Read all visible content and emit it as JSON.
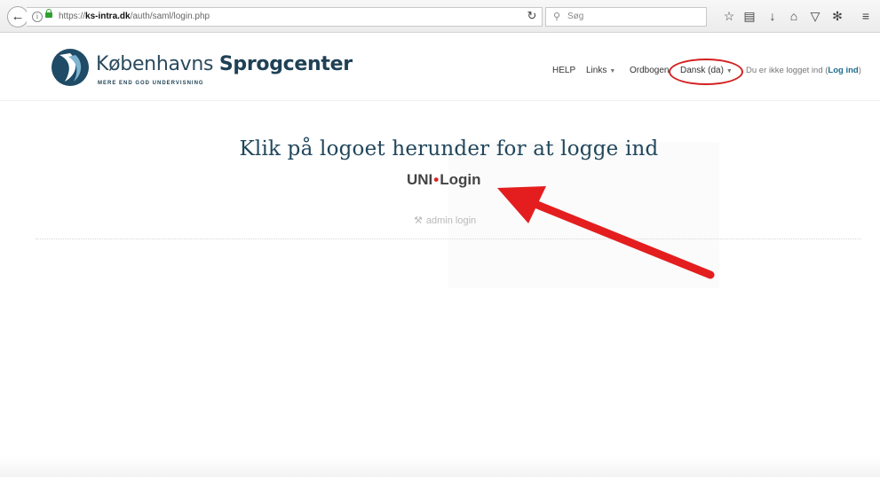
{
  "browser": {
    "url_prefix": "https://",
    "url_domain": "ks-intra.dk",
    "url_path": "/auth/saml/login.php",
    "search_placeholder": "Søg",
    "icons": [
      "back-arrow-icon",
      "info-icon",
      "lock-icon",
      "reload-icon",
      "search-icon",
      "star-icon",
      "reading-list-icon",
      "download-icon",
      "home-icon",
      "pocket-icon",
      "extension-icon",
      "menu-icon"
    ]
  },
  "site": {
    "logo_title_light": "Københavns ",
    "logo_title_bold": "Sprogcenter",
    "logo_tagline": "MERE END GOD UNDERVISNING",
    "brand_color": "#1f4156"
  },
  "nav": {
    "help": "HELP",
    "links": "Links",
    "ordbogen": "Ordbogen",
    "language": "Dansk (da)",
    "login_status": "Du er ikke logget ind (",
    "login_link": "Log ind",
    "login_close": ")"
  },
  "main": {
    "heading": "Klik på logoet herunder for at logge ind",
    "unilogin_left": "UNI",
    "unilogin_dot": "•",
    "unilogin_right": "Login",
    "admin_login": "admin login"
  },
  "annotation": {
    "highlight_color": "#d42020"
  }
}
